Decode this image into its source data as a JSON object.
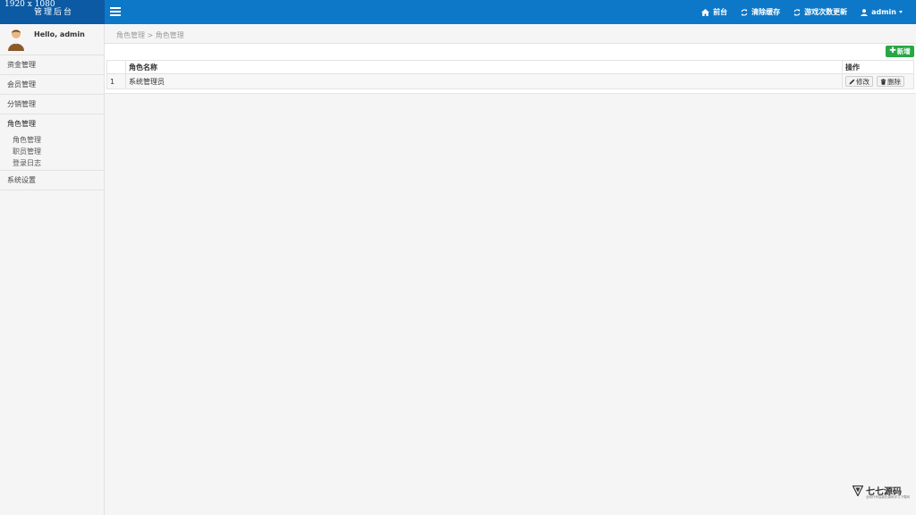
{
  "brand": {
    "line1": "1920 x 1080",
    "line2": "管理后台"
  },
  "topnav": {
    "home": {
      "label": "前台",
      "icon": "home-icon"
    },
    "clear_cache": {
      "label": "清除缓存",
      "icon": "refresh-icon"
    },
    "game_update": {
      "label": "游戏次数更新",
      "icon": "refresh-icon"
    },
    "user": {
      "label": "admin",
      "icon": "user-icon"
    }
  },
  "sidebar": {
    "greeting": "Hello, admin",
    "items": [
      {
        "label": "资金管理"
      },
      {
        "label": "会员管理"
      },
      {
        "label": "分销管理"
      }
    ],
    "open_group": {
      "label": "角色管理",
      "children": [
        {
          "label": "角色管理"
        },
        {
          "label": "职员管理"
        },
        {
          "label": "登录日志"
        }
      ]
    },
    "after_items": [
      {
        "label": "系统设置"
      }
    ]
  },
  "breadcrumb": "角色管理 > 角色管理",
  "toolbar": {
    "add_label": "新增"
  },
  "table": {
    "headers": [
      "",
      "角色名称",
      "操作"
    ],
    "rows": [
      {
        "index": "1",
        "name": "系统管理员",
        "edit": "修改",
        "delete": "删除"
      }
    ]
  },
  "watermark": {
    "title": "七七源码",
    "subtitle": "全网代号智能化源码学习下载网"
  },
  "colors": {
    "topbar": "#0d78c8",
    "brand_bg": "#0b5aa3",
    "add_button": "#28a745"
  }
}
